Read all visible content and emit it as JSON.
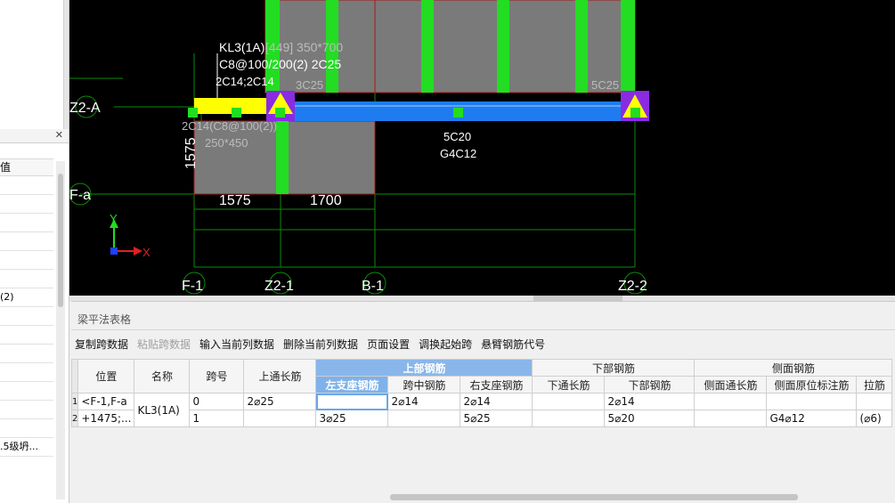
{
  "left_panel": {
    "header_col": "值",
    "rows": [
      "",
      "",
      "",
      "",
      "",
      "",
      "(2)",
      "",
      "",
      "",
      "",
      "",
      "",
      "",
      ".5级坍..."
    ]
  },
  "cad": {
    "beam_label_1": "KL3(1A)",
    "beam_label_1b": "[449] 350*700",
    "beam_label_2": "C8@100/200(2) 2C25",
    "beam_label_3": "2C14;2C14",
    "left_top_rebar": "3C25",
    "right_top_rebar": "5C25",
    "left_bottom_1": "2C14(C8@100(2))",
    "left_bottom_2": "250*450",
    "mid_bottom_1": "5C20",
    "mid_bottom_2": "G4C12",
    "dim_vertical": "1575",
    "dim_1": "1575",
    "dim_2": "1700",
    "axis_z2a": "Z2-A",
    "axis_fa": "F-a",
    "axis_f1": "F-1",
    "axis_z21": "Z2-1",
    "axis_b1": "B-1",
    "axis_z22": "Z2-2",
    "ucs_y": "Y",
    "ucs_x": "X",
    "colors": {
      "beam_blue": "#1e7cf0",
      "cantilever_yellow": "#ffff00",
      "column_green": "#22dd22",
      "support_purple": "#8a2be2",
      "slab_gray": "#7a7a7a",
      "grid_green": "#0b8a0b"
    }
  },
  "panel": {
    "title": "梁平法表格",
    "toolbar": [
      {
        "label": "复制跨数据",
        "enabled": true
      },
      {
        "label": "粘贴跨数据",
        "enabled": false
      },
      {
        "label": "输入当前列数据",
        "enabled": true
      },
      {
        "label": "删除当前列数据",
        "enabled": true
      },
      {
        "label": "页面设置",
        "enabled": true
      },
      {
        "label": "调换起始跨",
        "enabled": true
      },
      {
        "label": "悬臂钢筋代号",
        "enabled": true
      }
    ],
    "table": {
      "h_position": "位置",
      "h_name": "名称",
      "h_span": "跨号",
      "h_top_through": "上通长筋",
      "g_top": "上部钢筋",
      "g_bottom": "下部钢筋",
      "g_side": "侧面钢筋",
      "s_left_support": "左支座钢筋",
      "s_mid": "跨中钢筋",
      "s_right_support": "右支座钢筋",
      "s_bottom_through": "下通长筋",
      "s_bottom": "下部钢筋",
      "s_side_through": "侧面通长筋",
      "s_side_orig": "侧面原位标注筋",
      "s_tie": "拉筋",
      "position_1": "<F-1,F-a",
      "position_2": "+1475;...",
      "name": "KL3(1A)",
      "rows": [
        {
          "no": "1",
          "span": "0",
          "top_through": "2⌀25",
          "left": "",
          "mid": "2⌀14",
          "right": "2⌀14",
          "bottom_through": "",
          "bottom": "2⌀14",
          "side_through": "",
          "side_orig": "",
          "tie": ""
        },
        {
          "no": "2",
          "span": "1",
          "top_through": "",
          "left": "3⌀25",
          "mid": "",
          "right": "5⌀25",
          "bottom_through": "",
          "bottom": "5⌀20",
          "side_through": "",
          "side_orig": "G4⌀12",
          "tie": "(⌀6)"
        }
      ]
    }
  }
}
